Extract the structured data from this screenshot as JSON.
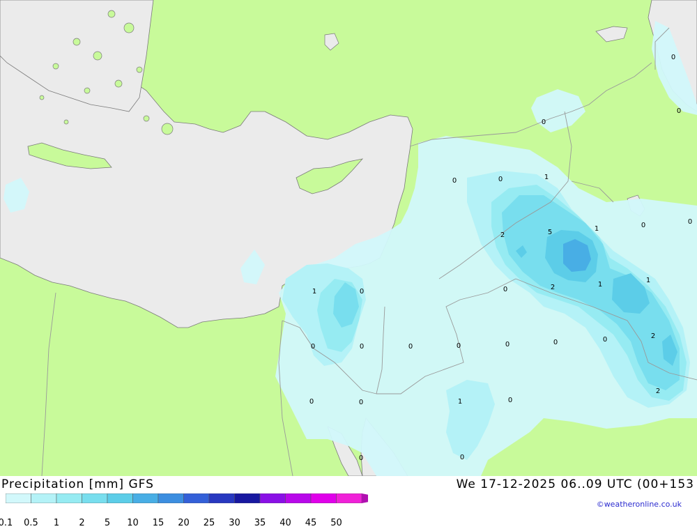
{
  "title": "Precipitation [mm] GFS",
  "datetime": "We 17-12-2025 06..09 UTC (00+153",
  "credit": "©weatheronline.co.uk",
  "colors": {
    "land": "#c8fa9a",
    "sea": "#ebebeb",
    "border": "#999999",
    "coast": "#7a7a7a"
  },
  "legend": {
    "ticks": [
      "0.1",
      "0.5",
      "1",
      "2",
      "5",
      "10",
      "15",
      "20",
      "25",
      "30",
      "35",
      "40",
      "45",
      "50"
    ],
    "colors": [
      "#d2f8fb",
      "#b4f2f7",
      "#96ebf2",
      "#78deee",
      "#5ccde8",
      "#48aee5",
      "#3c8ee0",
      "#3460d8",
      "#2838c0",
      "#1818a0",
      "#8a10e6",
      "#b808ea",
      "#e000ea",
      "#f020d8",
      "#b010b0"
    ]
  },
  "contour_labels": [
    {
      "text": "0",
      "id": "label-north-syria"
    },
    {
      "text": "0",
      "id": "label-turkey-east-1"
    },
    {
      "text": "0",
      "id": "label-turkey-east-2"
    },
    {
      "text": "0",
      "id": "label-syria-west"
    },
    {
      "text": "0",
      "id": "label-syria-central"
    },
    {
      "text": "1",
      "id": "label-syria-north"
    },
    {
      "text": "2",
      "id": "label-syria-iraq-border"
    },
    {
      "text": "5",
      "id": "label-iraq-west"
    },
    {
      "text": "1",
      "id": "label-iraq-north"
    },
    {
      "text": "0",
      "id": "label-iran-west-1"
    },
    {
      "text": "0",
      "id": "label-iran-west-2"
    },
    {
      "text": "1",
      "id": "label-sinai-north"
    },
    {
      "text": "0",
      "id": "label-israel"
    },
    {
      "text": "0",
      "id": "label-jordan-west"
    },
    {
      "text": "2",
      "id": "label-iraq-central"
    },
    {
      "text": "1",
      "id": "label-iraq-south-1"
    },
    {
      "text": "1",
      "id": "label-iraq-east"
    },
    {
      "text": "0",
      "id": "label-egypt-north"
    },
    {
      "text": "0",
      "id": "label-sinai"
    },
    {
      "text": "0",
      "id": "label-jordan"
    },
    {
      "text": "0",
      "id": "label-saudi-north-1"
    },
    {
      "text": "0",
      "id": "label-saudi-north-2"
    },
    {
      "text": "0",
      "id": "label-saudi-north-3"
    },
    {
      "text": "0",
      "id": "label-iraq-south-2"
    },
    {
      "text": "2",
      "id": "label-iraq-southeast"
    },
    {
      "text": "2",
      "id": "label-kuwait"
    },
    {
      "text": "0",
      "id": "label-egypt-east"
    },
    {
      "text": "0",
      "id": "label-sinai-south"
    },
    {
      "text": "1",
      "id": "label-saudi-northwest"
    },
    {
      "text": "0",
      "id": "label-saudi-north-4"
    },
    {
      "text": "0",
      "id": "label-red-sea"
    },
    {
      "text": "0",
      "id": "label-saudi-west"
    }
  ]
}
